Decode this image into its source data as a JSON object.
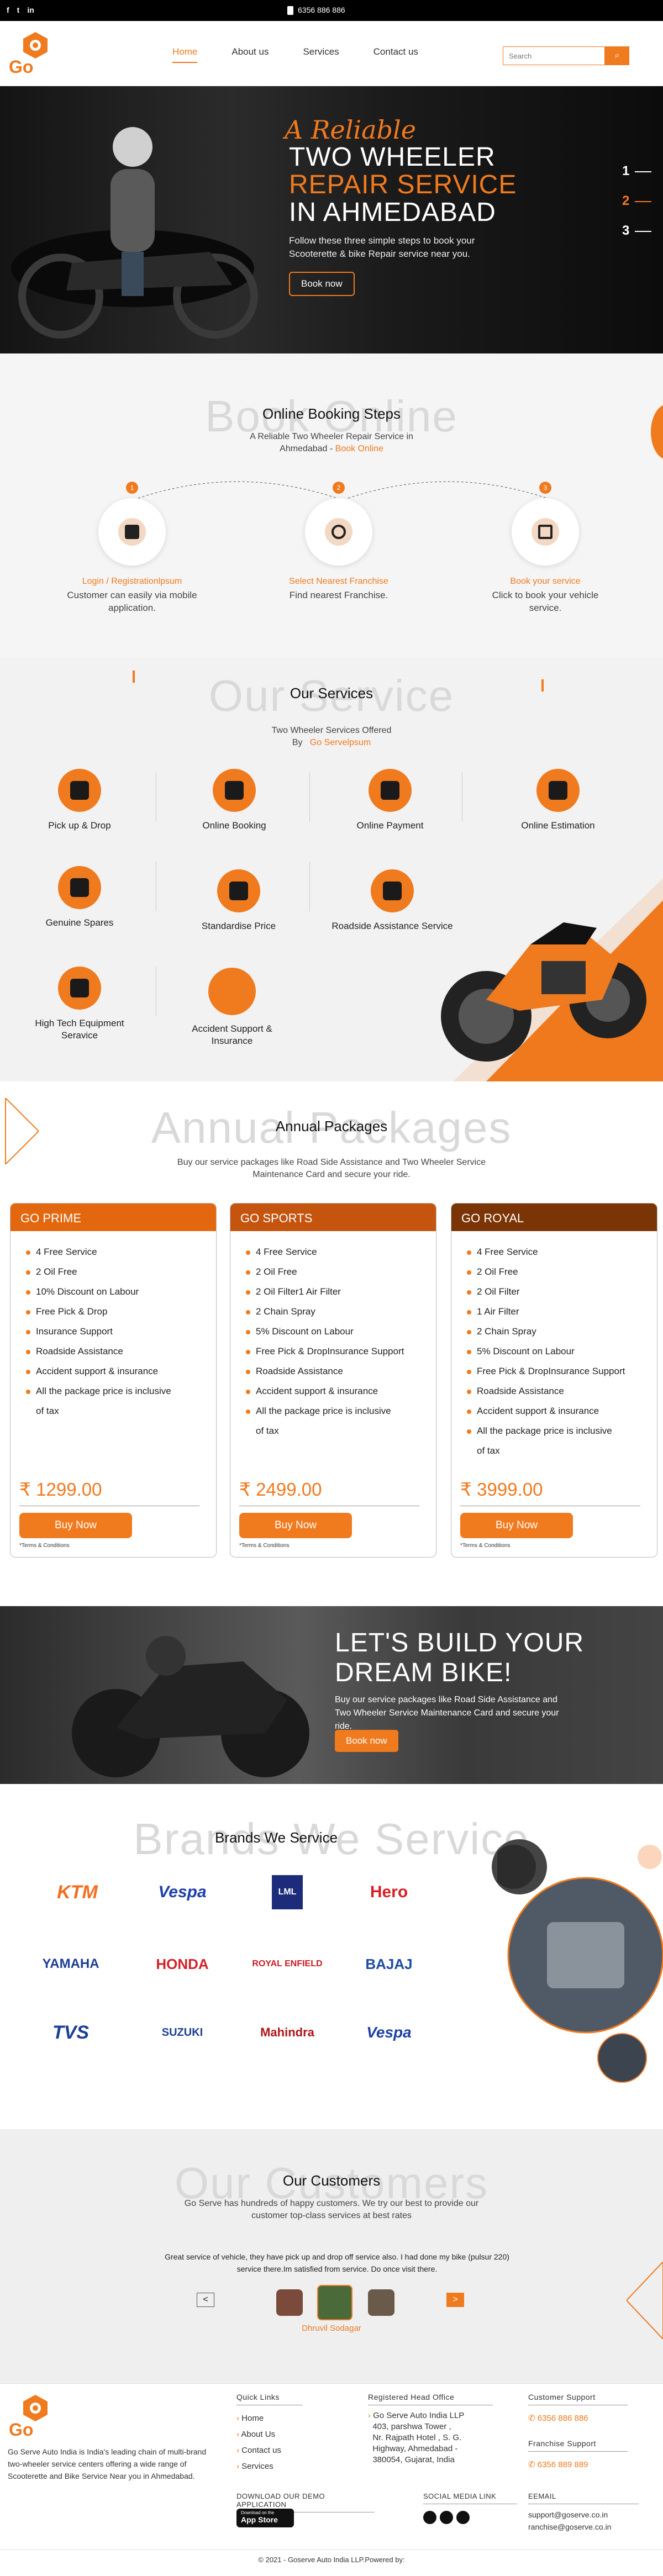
{
  "topbar": {
    "social": [
      "f",
      "t",
      "in"
    ],
    "phone": "6356 886 886"
  },
  "header": {
    "logo_text": "Go",
    "nav": [
      {
        "label": "Home",
        "active": true
      },
      {
        "label": "About us"
      },
      {
        "label": "Services"
      },
      {
        "label": "Contact us"
      }
    ],
    "search_placeholder": "Search"
  },
  "hero": {
    "script_title": "A Reliable",
    "line1": "TWO WHEELER",
    "line2": "REPAIR SERVICE",
    "line3": "IN AHMEDABAD",
    "subtitle": "Follow these three simple steps to book your Scooterette & bike Repair service near you.",
    "button": "Book now",
    "slides": [
      "1",
      "2",
      "3"
    ]
  },
  "booking": {
    "watermark": "Book Online",
    "title": "Online Booking Steps",
    "subtitle": "A Reliable Two Wheeler Repair Service in",
    "subtitle2": "Ahmedabad -",
    "subtitle_link": "Book Online",
    "steps": [
      {
        "num": "1",
        "title": "Login / Registrationlpsum",
        "desc": "Customer can easily via mobile application."
      },
      {
        "num": "2",
        "title": "Select Nearest Franchise",
        "desc": "Find nearest Franchise."
      },
      {
        "num": "3",
        "title": "Book your service",
        "desc": "Click to book your vehicle service."
      }
    ]
  },
  "services": {
    "watermark": "Our Service",
    "title": "Our Services",
    "subtitle": "Two Wheeler Services Offered",
    "by": "By",
    "brand": "Go Servelpsum",
    "items": [
      "Pick up & Drop",
      "Online Booking",
      "Online Payment",
      "Online Estimation",
      "Genuine Spares",
      "Standardise Price",
      "Roadside Assistance Service",
      "High Tech Equipment Seravice",
      "Accident Support & Insurance"
    ]
  },
  "packages": {
    "watermark": "Annual Packages",
    "title": "Annual Packages",
    "subtitle": "Buy our service packages like Road Side Assistance and Two Wheeler Service Maintenance Card and secure your ride.",
    "cards": [
      {
        "name": "GO PRIME",
        "color": "#e3670f",
        "price": "₹ 1299.00",
        "button": "Buy Now",
        "terms": "*Terms & Conditions",
        "features": [
          "4 Free Service",
          "2 Oil Free",
          "10% Discount on Labour",
          "Free Pick & Drop",
          "Insurance Support",
          "Roadside Assistance",
          "Accident support & insurance",
          "All the package price is inclusive",
          "of tax"
        ]
      },
      {
        "name": "GO SPORTS",
        "color": "#c4540e",
        "price": "₹ 2499.00",
        "button": "Buy Now",
        "terms": "*Terms & Conditions",
        "features": [
          "4 Free Service",
          "2 Oil Free",
          "2 Oil Filter1 Air Filter",
          "2 Chain Spray",
          "5% Discount on Labour",
          "Free Pick & DropInsurance Support",
          "Roadside Assistance",
          "Accident support & insurance",
          "All the package price is inclusive",
          "of tax"
        ]
      },
      {
        "name": "GO ROYAL",
        "color": "#7a3406",
        "price": "₹ 3999.00",
        "button": "Buy Now",
        "terms": "*Terms & Conditions",
        "features": [
          "4 Free Service",
          "2 Oil Free",
          "2 Oil Filter",
          "1 Air Filter",
          "2 Chain Spray",
          "5% Discount on Labour",
          "Free Pick & DropInsurance Support",
          "Roadside Assistance",
          "Accident support & insurance",
          "All the package price is inclusive",
          "of tax"
        ]
      }
    ]
  },
  "build": {
    "line1": "LET'S BUILD YOUR",
    "line2": "DREAM BIKE!",
    "subtitle": "Buy our service packages like Road Side Assistance and Two Wheeler Service Maintenance Card and secure your ride.",
    "button": "Book now"
  },
  "brands": {
    "watermark": "Brands We Service",
    "title": "Brands We Service",
    "list": [
      "KTM",
      "Vespa",
      "LML",
      "Hero",
      "YAMAHA",
      "HONDA",
      "ROYAL ENFIELD",
      "BAJAJ",
      "TVS",
      "SUZUKI",
      "Mahindra",
      "Vespa"
    ]
  },
  "customers": {
    "watermark": "Our Customers",
    "title": "Our Customers",
    "subtitle": "Go Serve has hundreds of happy customers. We try our best to provide our customer top-class services at best rates",
    "review": "Great service of vehicle, they have pick up and drop off service also. I had done my bike (pulsur 220) service there.Im satisfied from service. Do once visit there.",
    "name": "Dhruvil Sodagar",
    "prev": "<",
    "next": ">"
  },
  "footer": {
    "about": "Go Serve Auto India is India's leading chain of multi-brand two-wheeler service centers offering a wide range of Scooterette and Bike Service Near you in Ahmedabad.",
    "quick_title": "Quick Links",
    "quick_links": [
      "Home",
      "About Us",
      "Contact us",
      "Services"
    ],
    "office_title": "Registered Head Office",
    "office": [
      "Go Serve Auto India LLP",
      "403, parshwa Tower ,",
      "Nr. Rajpath Hotel , S. G.",
      "Highway, Ahmedabad -",
      "380054, Gujarat, India"
    ],
    "support_title": "Customer Support",
    "support_phone": "6356 886 886",
    "franchise_title": "Franchise Support",
    "franchise_phone": "6356 889 889",
    "app_title": "DOWNLOAD OUR DEMO APPLICATION",
    "app_small": "Download on the",
    "app_big": "App Store",
    "social_title": "SOCIAL MEDIA LINK",
    "email_title": "EEMAIL",
    "emails": [
      "support@goserve.co.in",
      "ranchise@goserve.co.in"
    ],
    "copyright": "© 2021 - Goserve Auto India LLP.Powered by:"
  },
  "colors": {
    "accent": "#f07a1e",
    "dark": "#000000"
  }
}
